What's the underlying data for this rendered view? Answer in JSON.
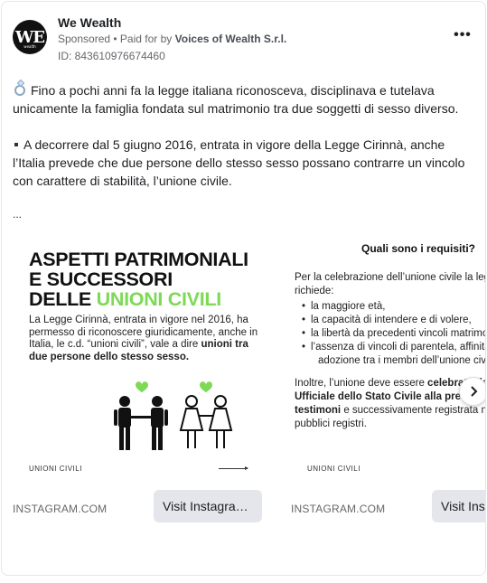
{
  "ad": {
    "page_name": "We Wealth",
    "sponsored": "Sponsored",
    "paid_for_prefix": "• Paid for by",
    "payer": "Voices of Wealth S.r.l.",
    "ad_id": "ID: 843610976674460",
    "avatar_letters": "WE",
    "avatar_sub": "wealth",
    "more_label": "•••"
  },
  "body": {
    "paragraph1": "Fino a pochi anni fa la legge italiana riconosceva, disciplinava e tutelava unicamente la famiglia fondata sul matrimonio tra due soggetti di sesso diverso.",
    "paragraph2": "A decorrere dal 5 giugno 2016, entrata in vigore della Legge Cirinnà, anche l’Italia prevede che due persone dello stesso sesso possano contrarre un vincolo con carattere di stabilità, l’unione civile.",
    "ellipsis": "..."
  },
  "carousel": {
    "slides": [
      {
        "title_line1": "ASPETTI PATRIMONIALI",
        "title_line2": "E SUCCESSORI",
        "title_line3_prefix": "DELLE ",
        "title_line3_accent": "UNIONI CIVILI",
        "desc_plain": "La Legge Cirinnà, entrata in vigore nel 2016, ha permesso di riconoscere giuridicamente, anche in Italia, le c.d. “unioni civili”, vale a dire ",
        "desc_bold": "unioni tra due persone dello stesso sesso.",
        "footer_label": "UNIONI CIVILI",
        "source": "INSTAGRAM.COM",
        "cta": "Visit Instagram profile"
      },
      {
        "title": "Quali sono i requisiti?",
        "intro": "Per la celebrazione dell’unione civile la legge italiana richiede:",
        "items": [
          "la maggiore età,",
          "la capacità di intendere e di volere,",
          "la libertà da precedenti vincoli matrimoniali,",
          "l’assenza di vincoli di parentela, affinità o",
          "adozione tra i membri dell’unione civile."
        ],
        "outro_plain1": "Inoltre, l’unione deve essere ",
        "outro_bold1": "celebrata davanti all’",
        "outro_bold2": "Ufficiale dello Stato Civile alla presenza di due",
        "outro_bold3": "testimoni",
        "outro_plain2": " e successivamente registrata negli",
        "outro_plain3": "pubblici registri.",
        "footer_label": "UNIONI CIVILI",
        "source": "INSTAGRAM.COM",
        "cta": "Visit Instagram profile"
      }
    ]
  },
  "colors": {
    "accent_green": "#7ed957",
    "cta_bg": "#e4e6eb",
    "muted_text": "#65676b"
  }
}
